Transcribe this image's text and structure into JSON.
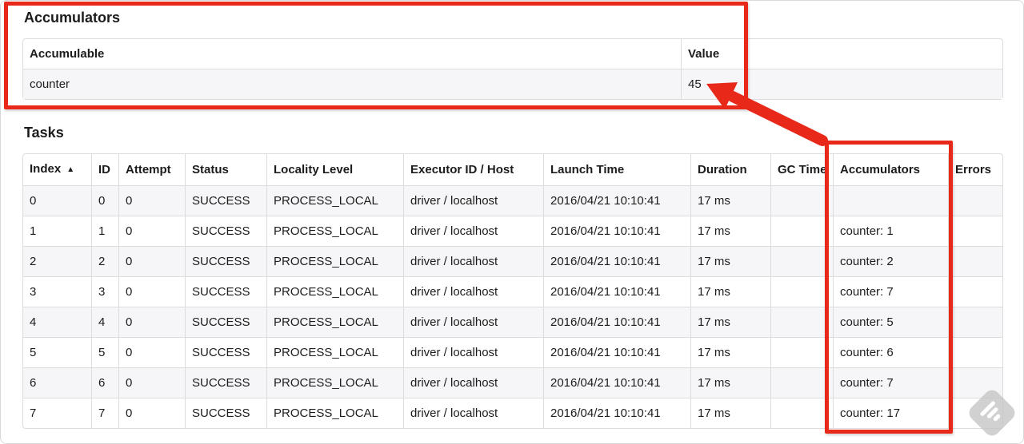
{
  "annotation": {
    "color": "#e8291a"
  },
  "accumulators": {
    "title": "Accumulators",
    "headers": [
      "Accumulable",
      "Value"
    ],
    "rows": [
      [
        "counter",
        "45"
      ]
    ]
  },
  "tasks": {
    "title": "Tasks",
    "sort_icon": "▲",
    "headers": [
      "Index",
      "ID",
      "Attempt",
      "Status",
      "Locality Level",
      "Executor ID / Host",
      "Launch Time",
      "Duration",
      "GC Time",
      "Accumulators",
      "Errors"
    ],
    "rows": [
      [
        "0",
        "0",
        "0",
        "SUCCESS",
        "PROCESS_LOCAL",
        "driver / localhost",
        "2016/04/21 10:10:41",
        "17 ms",
        "",
        "",
        ""
      ],
      [
        "1",
        "1",
        "0",
        "SUCCESS",
        "PROCESS_LOCAL",
        "driver / localhost",
        "2016/04/21 10:10:41",
        "17 ms",
        "",
        "counter: 1",
        ""
      ],
      [
        "2",
        "2",
        "0",
        "SUCCESS",
        "PROCESS_LOCAL",
        "driver / localhost",
        "2016/04/21 10:10:41",
        "17 ms",
        "",
        "counter: 2",
        ""
      ],
      [
        "3",
        "3",
        "0",
        "SUCCESS",
        "PROCESS_LOCAL",
        "driver / localhost",
        "2016/04/21 10:10:41",
        "17 ms",
        "",
        "counter: 7",
        ""
      ],
      [
        "4",
        "4",
        "0",
        "SUCCESS",
        "PROCESS_LOCAL",
        "driver / localhost",
        "2016/04/21 10:10:41",
        "17 ms",
        "",
        "counter: 5",
        ""
      ],
      [
        "5",
        "5",
        "0",
        "SUCCESS",
        "PROCESS_LOCAL",
        "driver / localhost",
        "2016/04/21 10:10:41",
        "17 ms",
        "",
        "counter: 6",
        ""
      ],
      [
        "6",
        "6",
        "0",
        "SUCCESS",
        "PROCESS_LOCAL",
        "driver / localhost",
        "2016/04/21 10:10:41",
        "17 ms",
        "",
        "counter: 7",
        ""
      ],
      [
        "7",
        "7",
        "0",
        "SUCCESS",
        "PROCESS_LOCAL",
        "driver / localhost",
        "2016/04/21 10:10:41",
        "17 ms",
        "",
        "counter: 17",
        ""
      ]
    ]
  }
}
